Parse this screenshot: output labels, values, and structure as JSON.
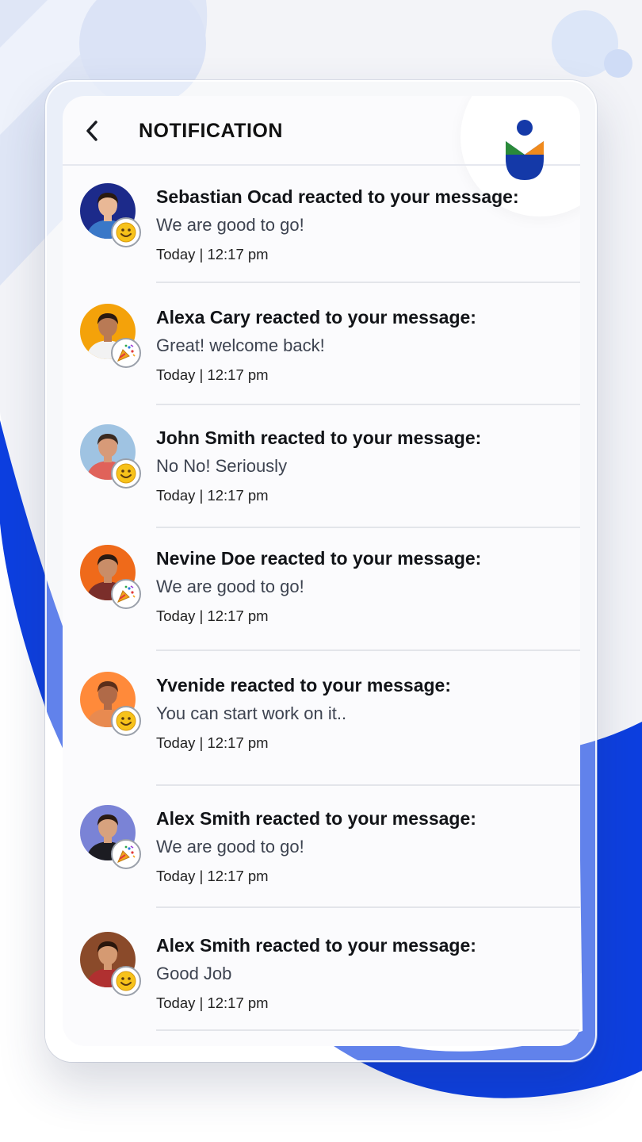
{
  "header": {
    "title": "NOTIFICATION"
  },
  "colors": {
    "brand_blue": "#0d3fe0",
    "logo_navy": "#1439a8",
    "logo_green": "#2a8a3a",
    "logo_orange": "#f08a1c"
  },
  "notifications": [
    {
      "title": "Sebastian Ocad reacted to your message:",
      "message": "We are good to go!",
      "time": "Today | 12:17 pm",
      "reaction": "smiley-icon",
      "avatar_bg": "#1c2a8a",
      "skin": "#e9b896",
      "shirt": "#3a78c8",
      "hair": "#2a1a10"
    },
    {
      "title": "Alexa Cary reacted to your message:",
      "message": "Great! welcome back!",
      "time": "Today | 12:17 pm",
      "reaction": "party-icon",
      "avatar_bg": "#f4a20a",
      "skin": "#b97a55",
      "shirt": "#f2f2f2",
      "hair": "#2b1a12"
    },
    {
      "title": "John Smith reacted to your message:",
      "message": "No No! Seriously",
      "time": "Today | 12:17 pm",
      "reaction": "smiley-icon",
      "avatar_bg": "#9fc3e2",
      "skin": "#d79a78",
      "shirt": "#e0625a",
      "hair": "#3a2a20"
    },
    {
      "title": "Nevine Doe reacted to your message:",
      "message": "We are good to go!",
      "time": "Today | 12:17 pm",
      "reaction": "party-icon",
      "avatar_bg": "#ef6a1a",
      "skin": "#c98d68",
      "shirt": "#7a2e2a",
      "hair": "#2a1a12"
    },
    {
      "title": "Yvenide reacted to your message:",
      "message": "You can start work on it..",
      "time": "Today | 12:17 pm",
      "reaction": "smiley-icon",
      "avatar_bg": "#ff8a3a",
      "skin": "#b06a48",
      "shirt": "#e88a50",
      "hair": "#5a2e1a"
    },
    {
      "title": "Alex Smith reacted to your message:",
      "message": "We are good to go!",
      "time": "Today | 12:17 pm",
      "reaction": "party-icon",
      "avatar_bg": "#7a83d6",
      "skin": "#d7a27e",
      "shirt": "#1c1c22",
      "hair": "#2a1a12"
    },
    {
      "title": "Alex Smith reacted to your message:",
      "message": "Good Job",
      "time": "Today | 12:17 pm",
      "reaction": "smiley-icon",
      "avatar_bg": "#8a4a2a",
      "skin": "#d59a72",
      "shirt": "#b03030",
      "hair": "#2a160c"
    }
  ]
}
